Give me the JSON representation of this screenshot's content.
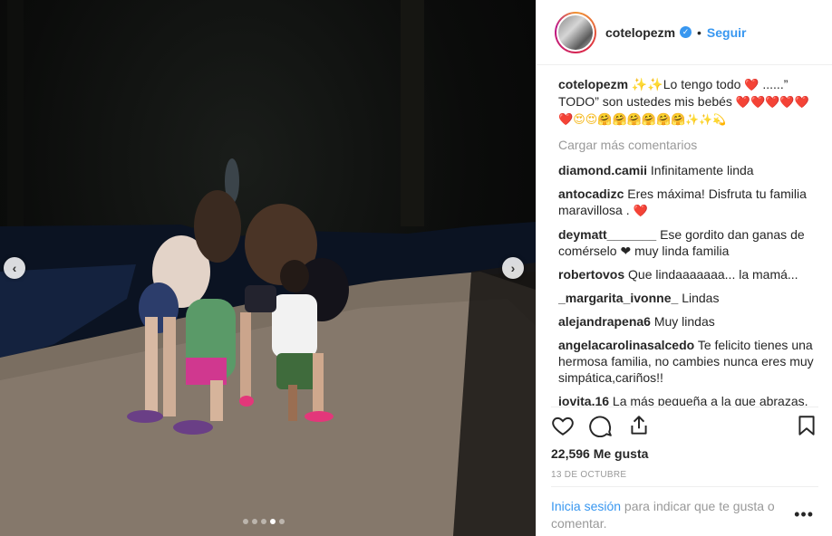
{
  "post": {
    "username": "cotelopezm",
    "verified_icon": "verified-badge-icon",
    "separator": "•",
    "follow_label": "Seguir"
  },
  "photo": {
    "carousel_dots": 5,
    "active_dot": 4,
    "prev_glyph": "‹",
    "next_glyph": "›"
  },
  "caption": {
    "username": "cotelopezm",
    "text_a": "✨✨Lo tengo todo ",
    "heart": "❤️",
    "text_b": " ......” TODO” son ustedes mis bebés ",
    "hearts": "❤️❤️❤️❤️❤️❤️",
    "faces": "😍😍🤗🤗🤗🤗🤗🤗",
    "sparkles": "✨✨💫"
  },
  "load_more": "Cargar más comentarios",
  "comments": [
    {
      "user": "diamond.camii",
      "text": "Infinitamente linda",
      "emoji": ""
    },
    {
      "user": "antocadizc",
      "text": "Eres máxima! Disfruta tu familia maravillosa . ",
      "emoji": "❤️"
    },
    {
      "user": "deymatt_______",
      "text": "Ese gordito dan ganas de comérselo ❤ muy linda familia",
      "emoji": ""
    },
    {
      "user": "robertovos",
      "text": "Que lindaaaaaaa... la mamá...",
      "emoji": ""
    },
    {
      "user": "_margarita_ivonne_",
      "text": "Lindas",
      "emoji": ""
    },
    {
      "user": "alejandrapena6",
      "text": "Muy lindas",
      "emoji": ""
    },
    {
      "user": "angelacarolinasalcedo",
      "text": "Te felicito tienes una hermosa familia, no cambies nunca eres muy simpática,cariños!!",
      "emoji": ""
    },
    {
      "user": "jovita.16",
      "text": "La más pequeña a la que abrazas, es tu clon! Hermosas todas ",
      "emoji": "😍😍😍"
    }
  ],
  "likes": "22,596 Me gusta",
  "date": "13 DE OCTUBRE",
  "login": {
    "link": "Inicia sesión",
    "rest": " para indicar que te gusta o comentar."
  },
  "more_label": "•••"
}
